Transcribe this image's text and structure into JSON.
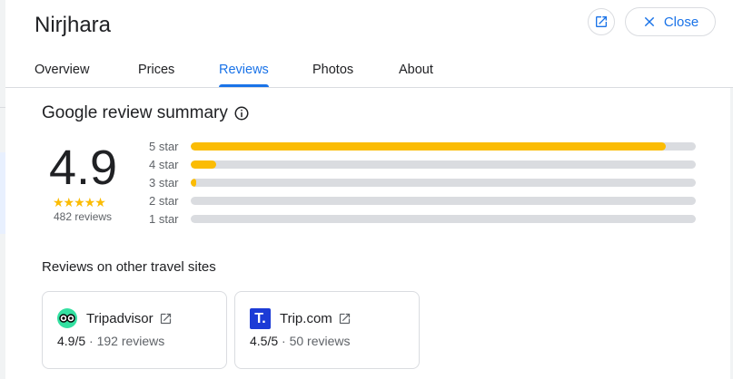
{
  "header": {
    "title": "Nirjhara",
    "close_label": "Close"
  },
  "tabs": [
    {
      "label": "Overview",
      "active": false
    },
    {
      "label": "Prices",
      "active": false
    },
    {
      "label": "Reviews",
      "active": true
    },
    {
      "label": "Photos",
      "active": false
    },
    {
      "label": "About",
      "active": false
    }
  ],
  "summary": {
    "title": "Google review summary",
    "rating": "4.9",
    "stars_text": "★★★★★",
    "review_count": "482 reviews",
    "breakdown": [
      {
        "label": "5 star",
        "fraction": 0.94
      },
      {
        "label": "4 star",
        "fraction": 0.05
      },
      {
        "label": "3 star",
        "fraction": 0.01
      },
      {
        "label": "2 star",
        "fraction": 0.0
      },
      {
        "label": "1 star",
        "fraction": 0.0
      }
    ]
  },
  "other_sites": {
    "title": "Reviews on other travel sites",
    "sites": [
      {
        "name": "Tripadvisor",
        "score": "4.9/5",
        "reviews": " · 192 reviews",
        "logo": "tripadvisor-logo"
      },
      {
        "name": "Trip.com",
        "score": "4.5/5",
        "reviews": " · 50 reviews",
        "logo": "trip-com-logo",
        "logo_letter": "T."
      }
    ]
  },
  "colors": {
    "accent": "#1a73e8",
    "star": "#fbbc04",
    "track": "#dadce0",
    "tripadvisor": "#34e0a1",
    "tripcom": "#1c3bd6"
  }
}
